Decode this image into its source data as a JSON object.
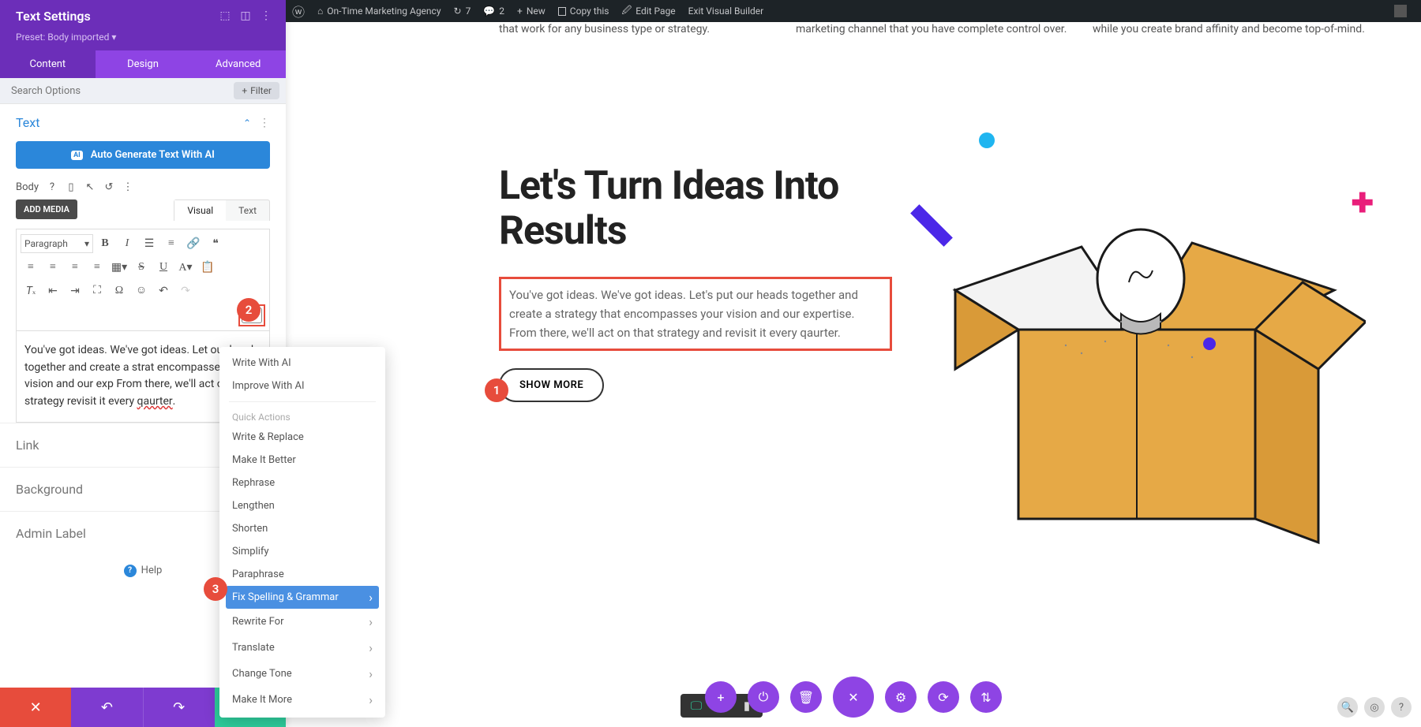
{
  "admin_bar": {
    "site_name": "On-Time Marketing Agency",
    "updates": "7",
    "comments": "2",
    "new": "New",
    "copy": "Copy this",
    "edit": "Edit Page",
    "exit": "Exit Visual Builder"
  },
  "panel": {
    "header_title": "Text Settings",
    "preset_label": "Preset: Body imported ▾",
    "tabs": {
      "content": "Content",
      "design": "Design",
      "advanced": "Advanced"
    },
    "search_placeholder": "Search Options",
    "filter_label": "Filter",
    "text_section": "Text",
    "ai_generate": "Auto Generate Text With AI",
    "body_label": "Body",
    "add_media": "ADD MEDIA",
    "editor_tabs": {
      "visual": "Visual",
      "text": "Text"
    },
    "paragraph": "Paragraph",
    "ai_btn": "AI",
    "editor_content_prefix": "You've got ideas. We've got ideas. Let our heads together and create a strat encompasses your vision and our exp From there, we'll act on that strategy revisit it every ",
    "editor_err_word": "qaurter",
    "sections": {
      "link": "Link",
      "background": "Background",
      "admin": "Admin Label"
    },
    "help": "Help"
  },
  "ai_menu": {
    "write": "Write With AI",
    "improve": "Improve With AI",
    "quick_head": "Quick Actions",
    "items": [
      "Write & Replace",
      "Make It Better",
      "Rephrase",
      "Lengthen",
      "Shorten",
      "Simplify",
      "Paraphrase"
    ],
    "highlight": "Fix Spelling & Grammar",
    "sub_items": [
      "Rewrite For",
      "Translate",
      "Change Tone",
      "Make It More"
    ]
  },
  "page_cards": {
    "card1": "that work for any business type or strategy.",
    "card2": "marketing channel that you have complete control over.",
    "card3": "while you create brand affinity and become top-of-mind."
  },
  "hero": {
    "title": "Let's Turn Ideas Into Results",
    "body": "You've got ideas. We've got ideas. Let's put our heads together and create a strategy that encompasses your vision and our expertise. From there, we'll act on that strategy and revisit it every qaurter.",
    "cta": "SHOW MORE"
  },
  "markers": {
    "m1": "1",
    "m2": "2",
    "m3": "3"
  }
}
